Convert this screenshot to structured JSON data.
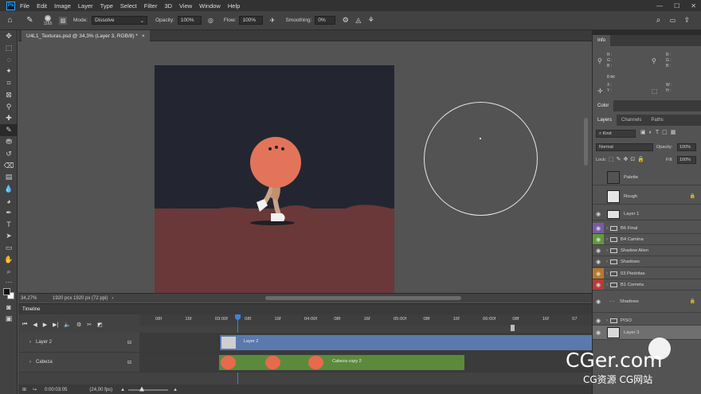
{
  "menu": [
    "File",
    "Edit",
    "Image",
    "Layer",
    "Type",
    "Select",
    "Filter",
    "3D",
    "View",
    "Window",
    "Help"
  ],
  "app_logo": "Ps",
  "window_controls": {
    "min": "—",
    "max": "☐",
    "close": "✕"
  },
  "options": {
    "brush_size": "1165",
    "mode_label": "Mode:",
    "mode_value": "Dissolve",
    "opacity_label": "Opacity:",
    "opacity_value": "100%",
    "flow_label": "Flow:",
    "flow_value": "100%",
    "smoothing_label": "Smoothing:",
    "smoothing_value": "0%"
  },
  "document": {
    "tab_title": "U4L1_Texturas.psd @ 34,3% (Layer 3, RGB/8) *",
    "tab_close": "×",
    "zoom": "34,27%",
    "doc_size": "1920 pcx 1920 px (72 ppi)"
  },
  "panels": {
    "info_tab": "Info",
    "info_rgb": [
      "R :",
      "G :",
      "B :"
    ],
    "info_bits": "8-bit",
    "info_xy": [
      "X :",
      "Y :"
    ],
    "info_wh": [
      "W :",
      "H :"
    ],
    "color_tab": "Color",
    "layers_tabs": [
      "Layers",
      "Channels",
      "Paths"
    ],
    "kind_label": "Kind",
    "blend_mode": "Normal",
    "opacity_label": "Opacity:",
    "opacity_value": "100%",
    "lock_label": "Lock:",
    "fill_label": "Fill:",
    "fill_value": "100%"
  },
  "layers": [
    {
      "name": "Palette",
      "eye": false,
      "type": "thumb",
      "color": "#535353",
      "lock": false,
      "group": false
    },
    {
      "name": "Rough",
      "eye": false,
      "type": "thumb",
      "color": "#e6e6e6",
      "lock": true,
      "group": false
    },
    {
      "name": "Layer 1",
      "eye": true,
      "type": "thumb",
      "color": "#e0e0e0",
      "lock": false,
      "group": false
    },
    {
      "name": "B6 Final",
      "eye": true,
      "type": "group",
      "eyebg": "#7a5aa8",
      "lock": false,
      "group": true
    },
    {
      "name": "B4 Camina",
      "eye": true,
      "type": "group",
      "eyebg": "#5f9a3a",
      "lock": false,
      "group": true
    },
    {
      "name": "Shadow Alien",
      "eye": true,
      "type": "group",
      "lock": false,
      "group": true
    },
    {
      "name": "Shadows",
      "eye": true,
      "type": "group",
      "lock": false,
      "group": true
    },
    {
      "name": "03 Piedritas",
      "eye": true,
      "type": "group",
      "eyebg": "#b8772a",
      "lock": false,
      "group": true
    },
    {
      "name": "B1 Cometa",
      "eye": true,
      "type": "group",
      "eyebg": "#b83a3a",
      "lock": false,
      "group": true
    },
    {
      "name": "Shadows",
      "eye": true,
      "type": "dash",
      "lock": true,
      "group": false
    },
    {
      "name": "PISO",
      "eye": true,
      "type": "group",
      "lock": false,
      "group": true
    },
    {
      "name": "Layer 3",
      "eye": true,
      "type": "thumb",
      "color": "#d8d8d8",
      "lock": false,
      "group": false,
      "selected": true
    }
  ],
  "timeline": {
    "title": "Timeline",
    "ruler": [
      "08f",
      "16f",
      "03:00f",
      "08f",
      "16f",
      "04:00f",
      "08f",
      "16f",
      "05:00f",
      "08f",
      "16f",
      "06:00f",
      "08f",
      "16f",
      "07"
    ],
    "tracks": [
      {
        "name": "Layer 2",
        "clip_label": "Layer 2"
      },
      {
        "name": "Cabeza",
        "clip_label": "Cabeza copy 2"
      }
    ],
    "timecode": "0:00:03:05",
    "fps": "(24,00 fps)"
  },
  "colors": {
    "canvas_bg": "#232630",
    "ground": "#6a3838",
    "head": "#e86a4c",
    "track_blue": "#5a7aae",
    "track_green": "#5c8a3c"
  },
  "watermark": {
    "main": "CGer.com",
    "sub": "CG资源 CG网站"
  }
}
